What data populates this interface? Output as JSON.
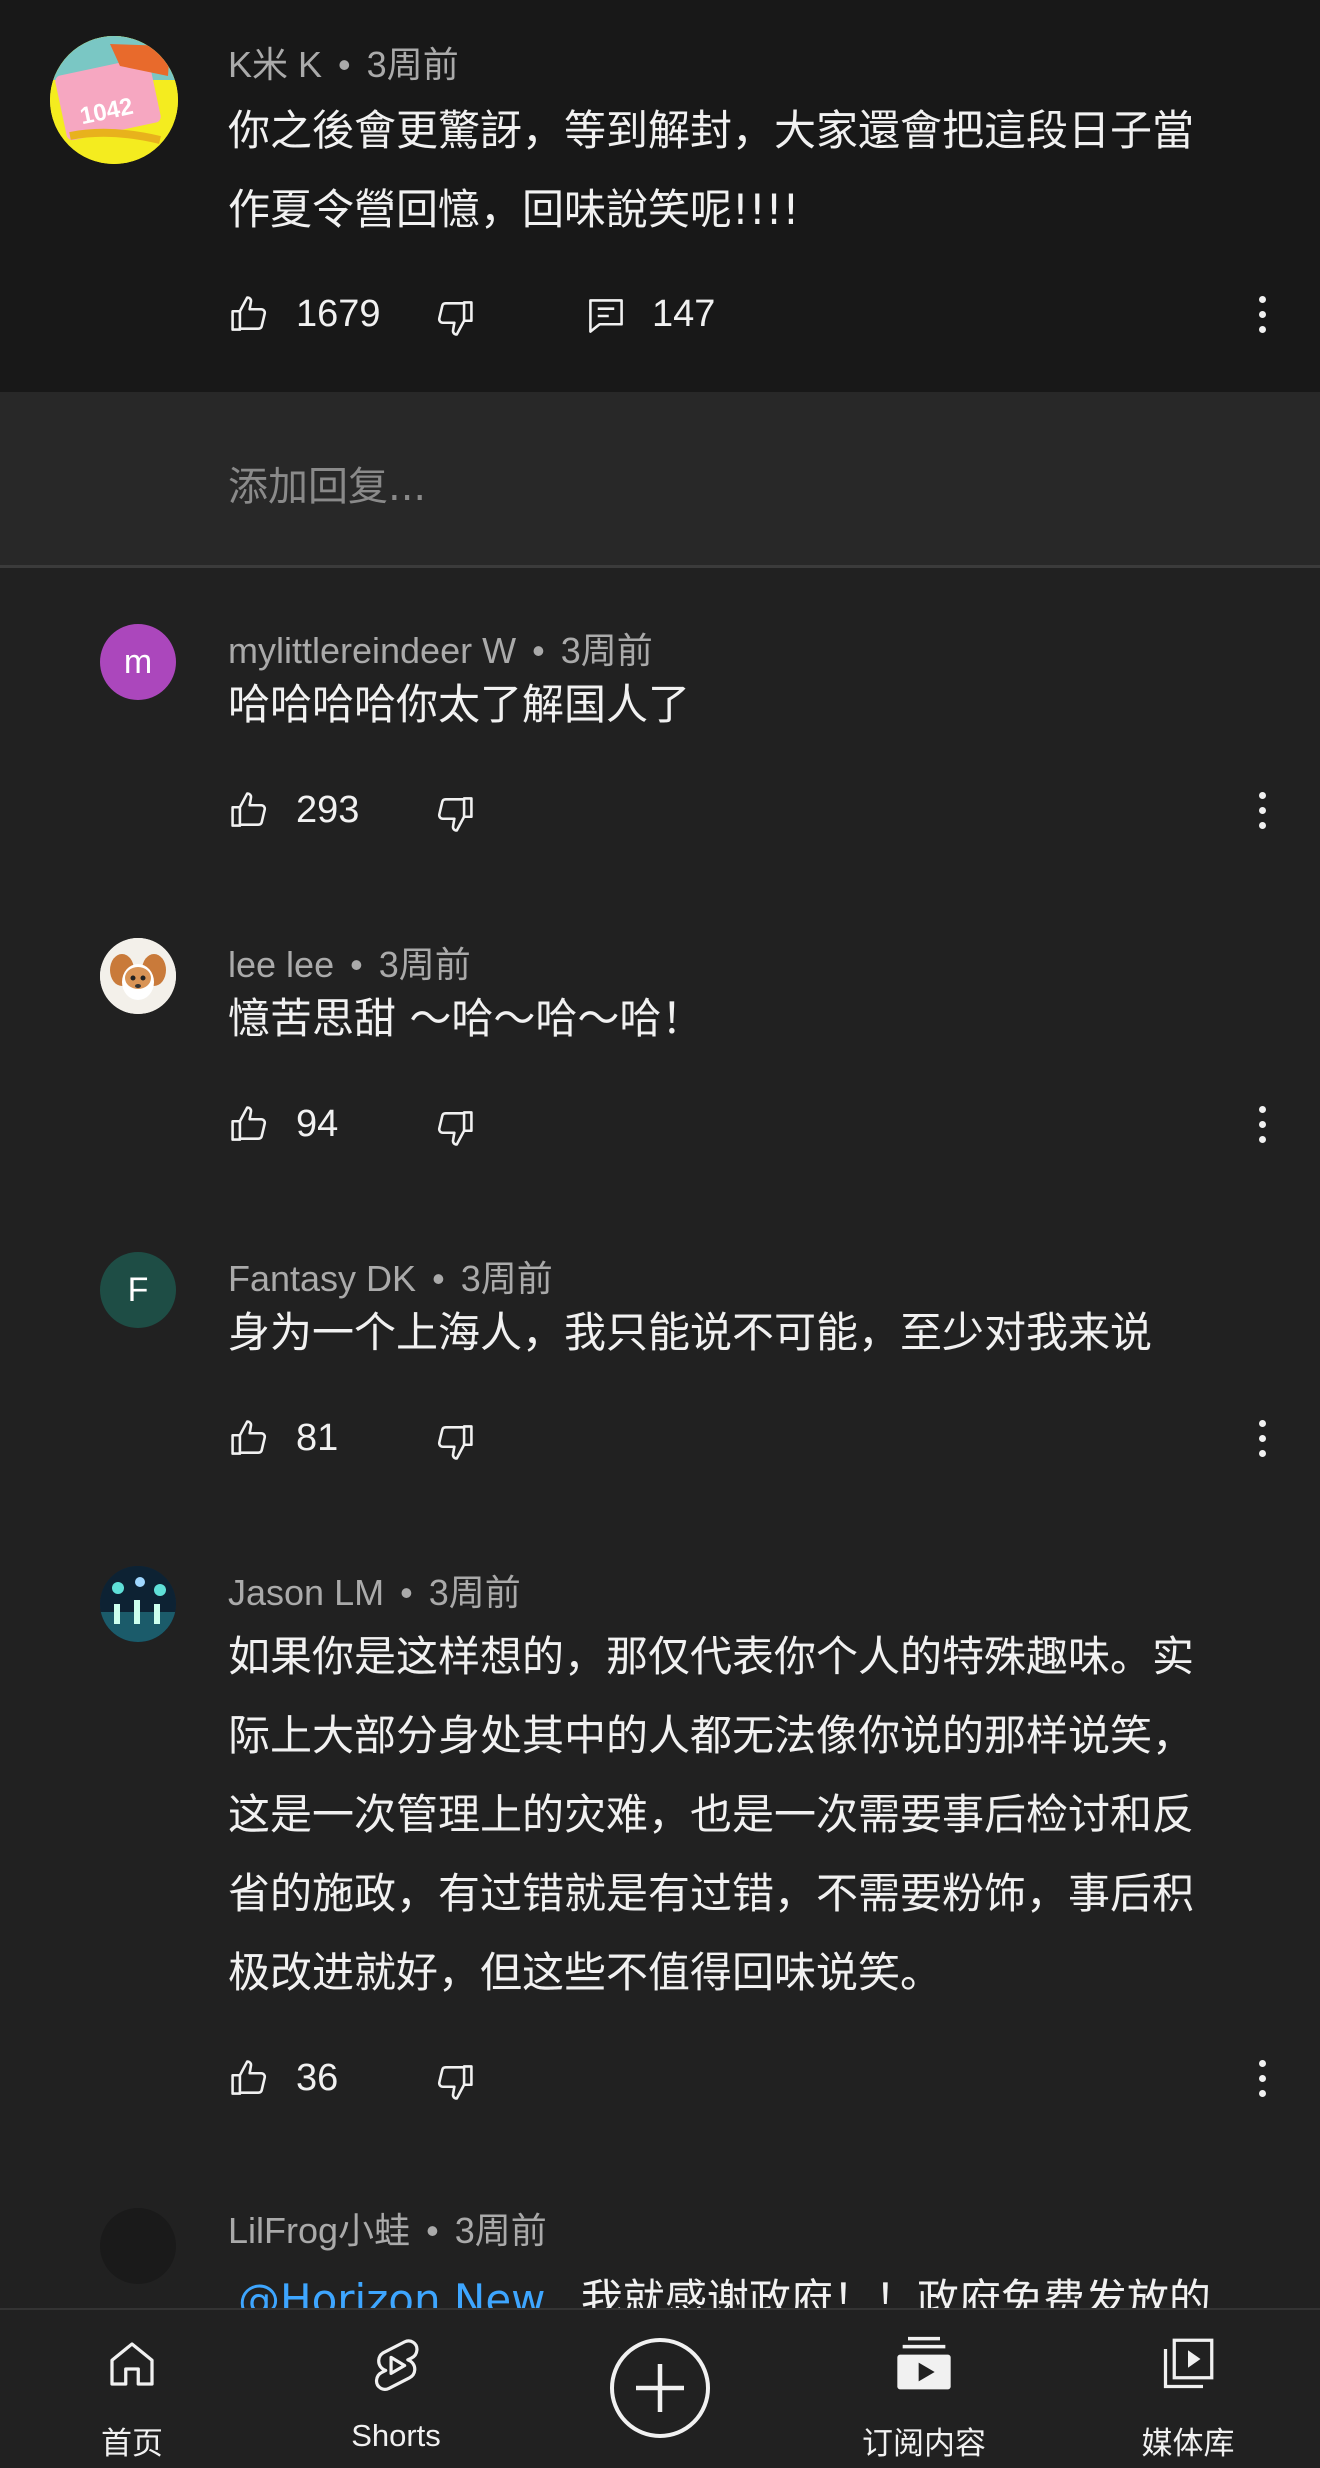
{
  "top_comment": {
    "author": "K米 K",
    "time": "3周前",
    "lines": [
      "你之後會更驚訝，等到解封，大家還會把這段日子當",
      "作夏令營回憶，回味說笑呢!!!!"
    ],
    "likes": "1679",
    "reply_count": "147",
    "avatar_text": "1042"
  },
  "reply_input": {
    "placeholder": "添加回复..."
  },
  "replies": [
    {
      "author": "mylittlereindeer W",
      "time": "3周前",
      "avatar_letter": "m",
      "avatar_color": "#ab47bc",
      "lines": [
        "哈哈哈哈你太了解国人了"
      ],
      "likes": "293"
    },
    {
      "author": "lee lee",
      "time": "3周前",
      "avatar_letter": "",
      "avatar_color": "#f2efe9",
      "lines": [
        "憶苦思甜 ～哈～哈～哈！"
      ],
      "likes": "94"
    },
    {
      "author": "Fantasy DK",
      "time": "3周前",
      "avatar_letter": "F",
      "avatar_color": "#1e4d45",
      "lines": [
        "身为一个上海人，我只能说不可能，至少对我来说"
      ],
      "likes": "81"
    },
    {
      "author": "Jason LM",
      "time": "3周前",
      "avatar_letter": "",
      "avatar_color": "#123047",
      "lines": [
        "如果你是这样想的，那仅代表你个人的特殊趣味。实",
        "际上大部分身处其中的人都无法像你说的那样说笑，",
        "这是一次管理上的灾难，也是一次需要事后检讨和反",
        "省的施政，有过错就是有过错，不需要粉饰，事后积",
        "极改进就好，但这些不值得回味说笑。"
      ],
      "likes": "36"
    },
    {
      "author": "LilFrog小蛙",
      "time": "3周前",
      "avatar_letter": "",
      "avatar_color": "#1a1a1a",
      "mention": "@Horizon New",
      "lines": [
        "我就感谢政府！！政府免费发放的"
      ],
      "likes": ""
    }
  ],
  "separator": "•",
  "bottom_nav": [
    {
      "label": "首页",
      "icon": "home-icon"
    },
    {
      "label": "Shorts",
      "icon": "shorts-icon"
    },
    {
      "label": "",
      "icon": "create-plus-icon"
    },
    {
      "label": "订阅内容",
      "icon": "subscriptions-icon"
    },
    {
      "label": "媒体库",
      "icon": "library-icon"
    }
  ]
}
